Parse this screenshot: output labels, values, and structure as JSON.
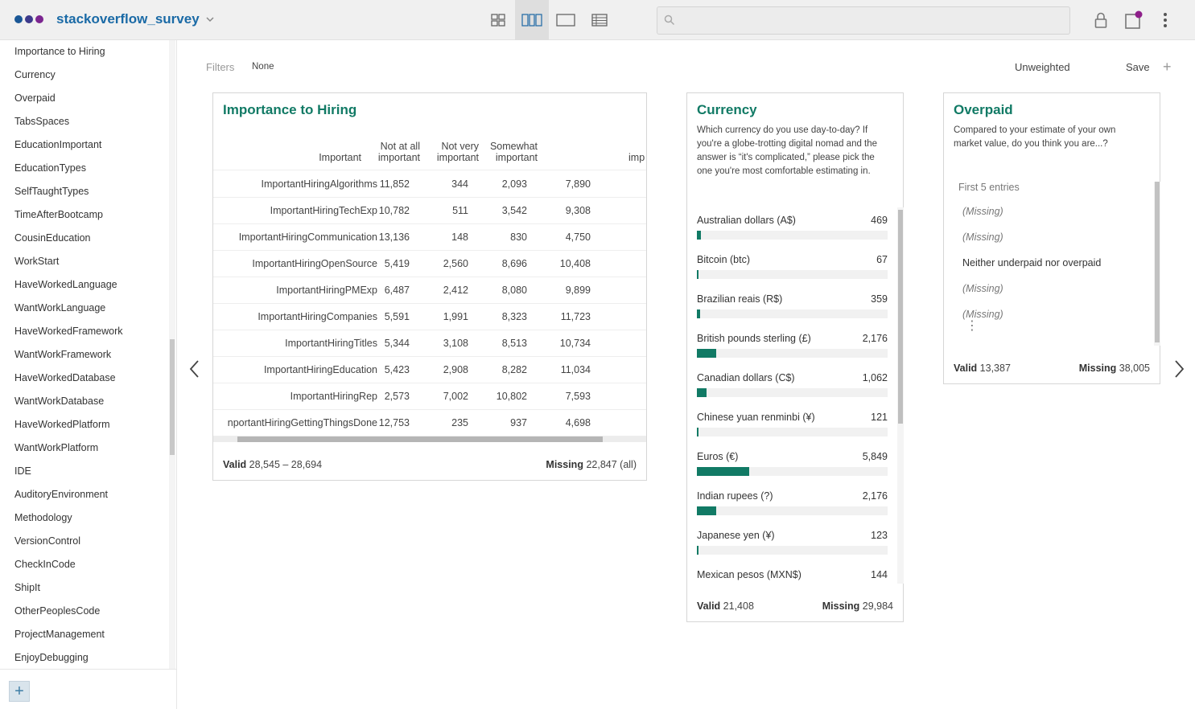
{
  "app": {
    "dataset_name": "stackoverflow_survey",
    "logo_colors": [
      "#1a5796",
      "#3d3a8c",
      "#7b2590"
    ],
    "accent_color": "#117a65",
    "notification_dot_color": "#8e1f8a"
  },
  "search": {
    "placeholder": "",
    "value": ""
  },
  "filters": {
    "label": "Filters",
    "value": "None"
  },
  "toolbar": {
    "weight_label": "Unweighted",
    "save_label": "Save",
    "add_label": "+"
  },
  "sidebar": {
    "items": [
      "Importance to Hiring",
      "Currency",
      "Overpaid",
      "TabsSpaces",
      "EducationImportant",
      "EducationTypes",
      "SelfTaughtTypes",
      "TimeAfterBootcamp",
      "CousinEducation",
      "WorkStart",
      "HaveWorkedLanguage",
      "WantWorkLanguage",
      "HaveWorkedFramework",
      "WantWorkFramework",
      "HaveWorkedDatabase",
      "WantWorkDatabase",
      "HaveWorkedPlatform",
      "WantWorkPlatform",
      "IDE",
      "AuditoryEnvironment",
      "Methodology",
      "VersionControl",
      "CheckInCode",
      "ShipIt",
      "OtherPeoplesCode",
      "ProjectManagement",
      "EnjoyDebugging"
    ],
    "add_button": "+"
  },
  "hiring": {
    "title": "Importance to Hiring",
    "columns": [
      [
        "Important"
      ],
      [
        "Not at all",
        "important"
      ],
      [
        "Not very",
        "important"
      ],
      [
        "Somewhat",
        "important"
      ],
      [
        "imp"
      ]
    ],
    "rows": [
      {
        "label": "ImportantHiringAlgorithms",
        "values": [
          "11,852",
          "344",
          "2,093",
          "7,890"
        ]
      },
      {
        "label": "ImportantHiringTechExp",
        "values": [
          "10,782",
          "511",
          "3,542",
          "9,308"
        ]
      },
      {
        "label": "ImportantHiringCommunication",
        "values": [
          "13,136",
          "148",
          "830",
          "4,750"
        ]
      },
      {
        "label": "ImportantHiringOpenSource",
        "values": [
          "5,419",
          "2,560",
          "8,696",
          "10,408"
        ]
      },
      {
        "label": "ImportantHiringPMExp",
        "values": [
          "6,487",
          "2,412",
          "8,080",
          "9,899"
        ]
      },
      {
        "label": "ImportantHiringCompanies",
        "values": [
          "5,591",
          "1,991",
          "8,323",
          "11,723"
        ]
      },
      {
        "label": "ImportantHiringTitles",
        "values": [
          "5,344",
          "3,108",
          "8,513",
          "10,734"
        ]
      },
      {
        "label": "ImportantHiringEducation",
        "values": [
          "5,423",
          "2,908",
          "8,282",
          "11,034"
        ]
      },
      {
        "label": "ImportantHiringRep",
        "values": [
          "2,573",
          "7,002",
          "10,802",
          "7,593"
        ]
      },
      {
        "label": "nportantHiringGettingThingsDone",
        "values": [
          "12,753",
          "235",
          "937",
          "4,698"
        ]
      }
    ],
    "footer": {
      "valid_label": "Valid",
      "valid_value": "28,545 – 28,694",
      "missing_label": "Missing",
      "missing_value": "22,847 (all)"
    }
  },
  "currency": {
    "title": "Currency",
    "description": "Which currency do you use day-to-day? If you're a globe-trotting digital nomad and the answer is “it's complicated,” please pick the one you're most comfortable estimating in.",
    "items": [
      {
        "label": "Australian dollars (A$)",
        "count": "469",
        "value": 469
      },
      {
        "label": "Bitcoin (btc)",
        "count": "67",
        "value": 67
      },
      {
        "label": "Brazilian reais (R$)",
        "count": "359",
        "value": 359
      },
      {
        "label": "British pounds sterling (£)",
        "count": "2,176",
        "value": 2176
      },
      {
        "label": "Canadian dollars (C$)",
        "count": "1,062",
        "value": 1062
      },
      {
        "label": "Chinese yuan renminbi (¥)",
        "count": "121",
        "value": 121
      },
      {
        "label": "Euros (€)",
        "count": "5,849",
        "value": 5849
      },
      {
        "label": "Indian rupees (?)",
        "count": "2,176",
        "value": 2176
      },
      {
        "label": "Japanese yen (¥)",
        "count": "123",
        "value": 123
      },
      {
        "label": "Mexican pesos (MXN$)",
        "count": "144",
        "value": 144
      }
    ],
    "bar_max": 21408,
    "footer": {
      "valid_label": "Valid",
      "valid_value": "21,408",
      "missing_label": "Missing",
      "missing_value": "29,984"
    }
  },
  "overpaid": {
    "title": "Overpaid",
    "description": "Compared to your estimate of your own market value, do you think you are...?",
    "list_header": "First 5 entries",
    "entries": [
      {
        "text": "(Missing)",
        "missing": true
      },
      {
        "text": "(Missing)",
        "missing": true
      },
      {
        "text": "Neither underpaid nor overpaid",
        "missing": false
      },
      {
        "text": "(Missing)",
        "missing": true
      },
      {
        "text": "(Missing)",
        "missing": true
      }
    ],
    "ellipsis": "⋮",
    "footer": {
      "valid_label": "Valid",
      "valid_value": "13,387",
      "missing_label": "Missing",
      "missing_value": "38,005"
    }
  }
}
